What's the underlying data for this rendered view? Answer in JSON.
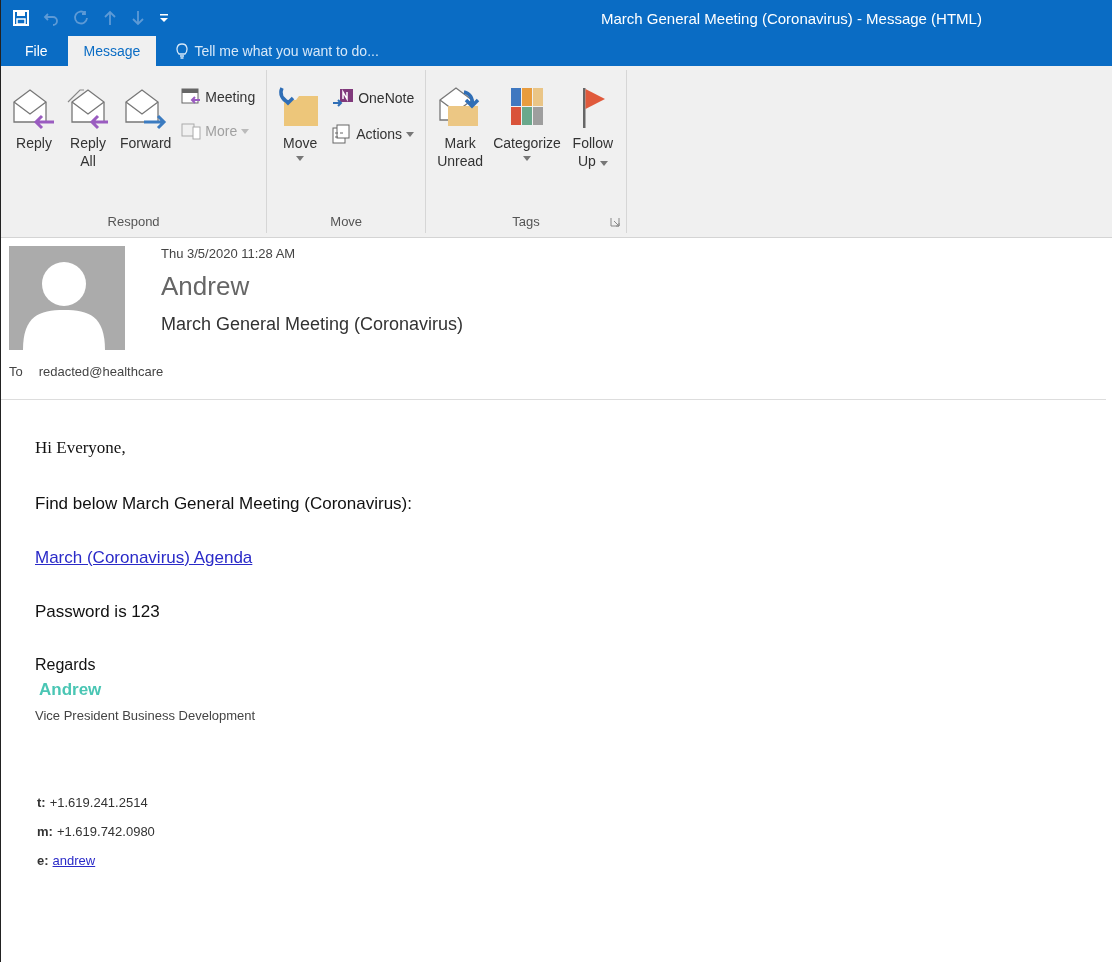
{
  "window": {
    "title": "March General Meeting (Coronavirus) - Message (HTML)"
  },
  "quick_access": [
    {
      "disabled": false
    },
    {
      "disabled": true
    },
    {
      "disabled": true
    },
    {
      "disabled": true
    },
    {
      "disabled": true
    },
    {
      "disabled": false
    }
  ],
  "tabs": [
    {
      "label": "File",
      "selected": false
    },
    {
      "label": "Message",
      "selected": true
    }
  ],
  "tell_me": {
    "placeholder": "Tell me what you want to do..."
  },
  "ribbon": [
    {
      "name": "Respond",
      "launcher": false,
      "buttons": [
        {
          "kind": "large",
          "lines": [
            "Reply"
          ],
          "has_menu": false,
          "disabled": false
        },
        {
          "kind": "large",
          "lines": [
            "Reply",
            "All"
          ],
          "has_menu": false,
          "disabled": false
        },
        {
          "kind": "large",
          "lines": [
            "Forward"
          ],
          "has_menu": false,
          "disabled": false
        },
        {
          "kind": "small",
          "lines": [
            "Meeting"
          ],
          "has_menu": false,
          "disabled": false
        },
        {
          "kind": "small",
          "lines": [
            "More"
          ],
          "has_menu": true,
          "disabled": true
        }
      ]
    },
    {
      "name": "Move",
      "launcher": false,
      "buttons": [
        {
          "kind": "large",
          "lines": [
            "Move"
          ],
          "has_menu": true,
          "disabled": false
        },
        {
          "kind": "small",
          "lines": [
            "OneNote"
          ],
          "has_menu": false,
          "disabled": false
        },
        {
          "kind": "small",
          "lines": [
            "Actions"
          ],
          "has_menu": true,
          "disabled": false
        }
      ]
    },
    {
      "name": "Tags",
      "launcher": true,
      "buttons": [
        {
          "kind": "large",
          "lines": [
            "Mark",
            "Unread"
          ],
          "has_menu": false,
          "disabled": false
        },
        {
          "kind": "large",
          "lines": [
            "Categorize"
          ],
          "has_menu": true,
          "disabled": false
        },
        {
          "kind": "large",
          "lines": [
            "Follow",
            "Up"
          ],
          "has_menu": true,
          "disabled": false
        }
      ]
    }
  ],
  "header": {
    "date": "Thu 3/5/2020 11:28 AM",
    "sender": "Andrew",
    "subject": "March General Meeting (Coronavirus)",
    "to_label": "To",
    "to": "redacted@healthcare"
  },
  "body": {
    "greeting": "Hi Everyone,",
    "intro": "Find below March General Meeting (Coronavirus):",
    "link": "March (Coronavirus) Agenda",
    "password": "Password is 123",
    "closing": "Regards"
  },
  "signature": {
    "name": "Andrew",
    "title": "Vice President Business Development",
    "contacts": [
      {
        "kind": "text",
        "label": "t:",
        "value": "+1.619.241.2514"
      },
      {
        "kind": "text",
        "label": "m:",
        "value": "+1.619.742.0980"
      },
      {
        "kind": "link",
        "label": "e:",
        "value": "andrew"
      }
    ]
  }
}
